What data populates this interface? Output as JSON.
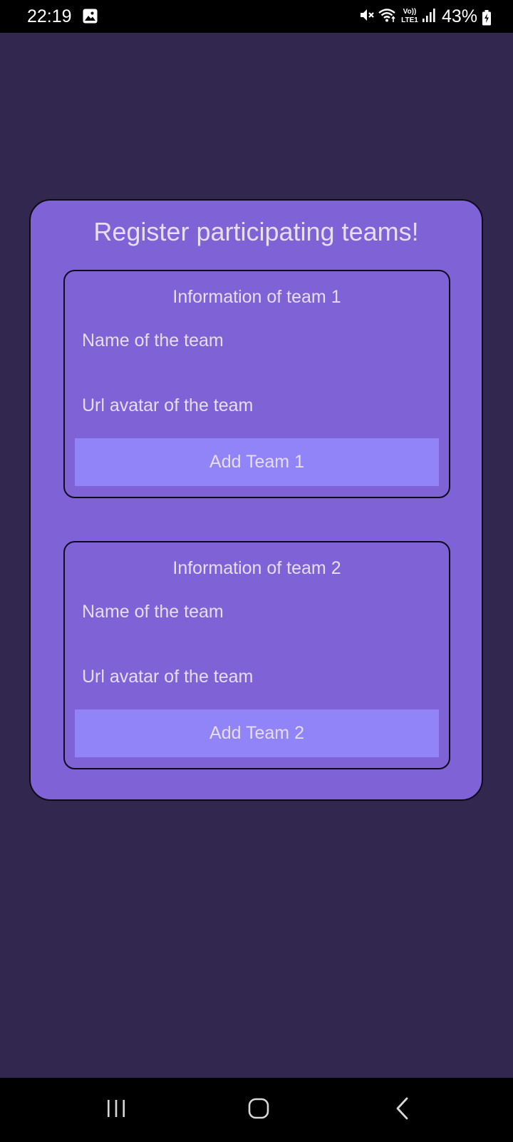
{
  "status_bar": {
    "time": "22:19",
    "battery_percent": "43%",
    "network_label_top": "Vo))",
    "network_label_bottom": "LTE1",
    "icons": [
      "gallery-icon",
      "mute-icon",
      "wifi-icon",
      "volte-lte-icon",
      "signal-icon",
      "battery-charging-icon"
    ]
  },
  "main": {
    "title": "Register participating teams!",
    "teams": [
      {
        "heading": "Information of team 1",
        "name_placeholder": "Name of the team",
        "url_placeholder": "Url avatar of the team",
        "button_label": "Add Team 1"
      },
      {
        "heading": "Information of team 2",
        "name_placeholder": "Name of the team",
        "url_placeholder": "Url avatar of the team",
        "button_label": "Add Team 2"
      }
    ]
  },
  "nav_bar": {
    "icons": [
      "recent-apps-icon",
      "home-icon",
      "back-icon"
    ]
  },
  "colors": {
    "background": "#32284F",
    "card": "#7F62D5",
    "button": "#9184F8",
    "text": "#E6DDF6",
    "bars": "#000000"
  }
}
